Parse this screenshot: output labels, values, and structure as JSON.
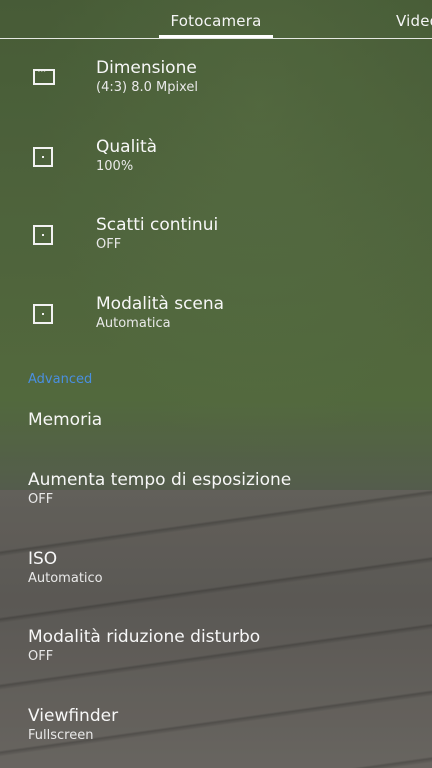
{
  "tabs": {
    "photo": "Fotocamera",
    "video": "Video"
  },
  "basic": [
    {
      "title": "Dimensione",
      "value": "(4:3) 8.0 Mpixel",
      "icon": "aspect-ratio-icon"
    },
    {
      "title": "Qualità",
      "value": "100%",
      "icon": "quality-icon"
    },
    {
      "title": "Scatti continui",
      "value": "OFF",
      "icon": "burst-icon"
    },
    {
      "title": "Modalità scena",
      "value": "Automatica",
      "icon": "scene-mode-icon"
    }
  ],
  "advanced_header": "Advanced",
  "advanced": [
    {
      "title": "Memoria",
      "value": ""
    },
    {
      "title": "Aumenta tempo di esposizione",
      "value": "OFF"
    },
    {
      "title": "ISO",
      "value": "Automatico"
    },
    {
      "title": "Modalità riduzione disturbo",
      "value": "OFF"
    },
    {
      "title": "Viewfinder",
      "value": "Fullscreen"
    }
  ],
  "colors": {
    "accent": "#4a8fe0",
    "text": "#f2f2f2"
  }
}
